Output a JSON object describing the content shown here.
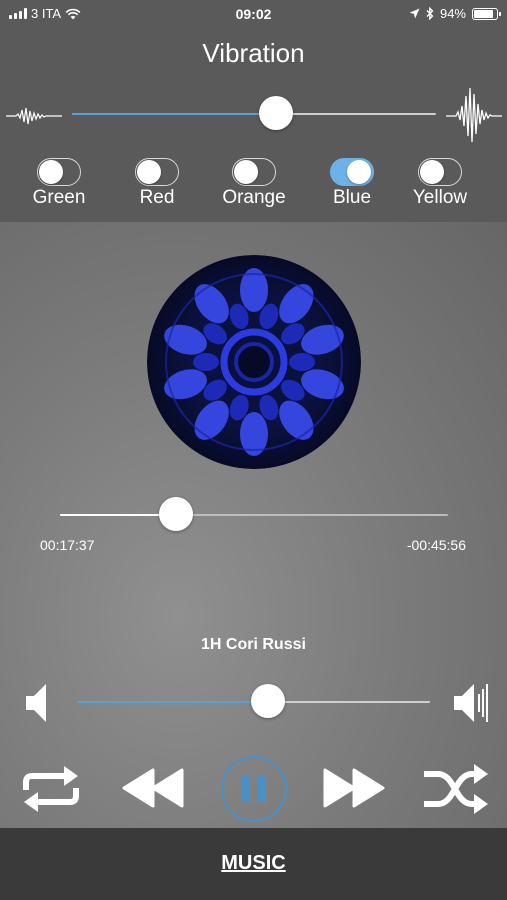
{
  "status_bar": {
    "carrier": "3 ITA",
    "time": "09:02",
    "battery": "94%",
    "battery_level": 0.94
  },
  "vibration": {
    "title": "Vibration",
    "slider_value": 0.56
  },
  "toggles": [
    {
      "label": "Green",
      "on": false
    },
    {
      "label": "Red",
      "on": false
    },
    {
      "label": "Orange",
      "on": false
    },
    {
      "label": "Blue",
      "on": true
    },
    {
      "label": "Yellow",
      "on": false
    }
  ],
  "player": {
    "progress": 0.298,
    "elapsed": "00:17:37",
    "remaining": "-00:45:56",
    "track_title": "1H Cori Russi",
    "volume": 0.54
  },
  "colors": {
    "accent": "#5aa0d8",
    "toggle_on": "#6cb2e8",
    "pause_ring": "#4a90c8"
  },
  "icons": {
    "repeat": "repeat-icon",
    "rewind": "rewind-icon",
    "pause": "pause-icon",
    "fast_forward": "fast-forward-icon",
    "shuffle": "shuffle-icon"
  },
  "bottom_bar": {
    "tab_label": "MUSIC"
  }
}
